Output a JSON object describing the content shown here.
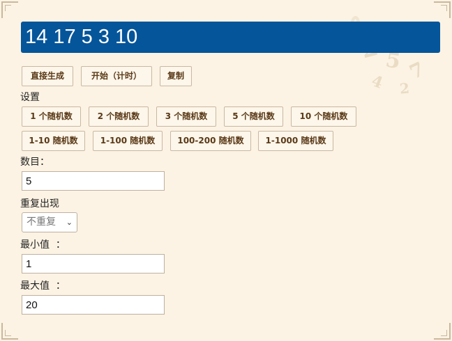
{
  "result": {
    "text": "14 17 5 3 10"
  },
  "actions": {
    "generate": "直接生成",
    "start_timed": "开始（计时）",
    "copy": "复制"
  },
  "settings": {
    "title": "设置",
    "count_presets": [
      "1 个随机数",
      "2 个随机数",
      "3 个随机数",
      "5 个随机数",
      "10 个随机数"
    ],
    "range_presets": [
      "1-10 随机数",
      "1-100 随机数",
      "100-200 随机数",
      "1-1000 随机数"
    ]
  },
  "form": {
    "count_label": "数目：",
    "count_value": "5",
    "repeat_label": "重复出现",
    "repeat_selected": "不重复",
    "min_label": "最小值  ：",
    "min_value": "1",
    "max_label": "最大值  ：",
    "max_value": "20"
  },
  "colors": {
    "background": "#fcf3e4",
    "result_bg": "#05559a",
    "button_text": "#5a3a18"
  }
}
